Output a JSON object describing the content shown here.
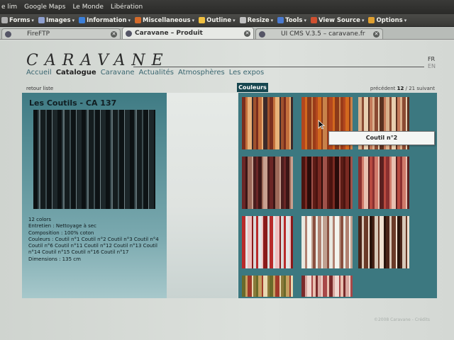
{
  "browser": {
    "menu_items": [
      "e lim",
      "Google Maps",
      "Le Monde",
      "Libération"
    ],
    "toolbar_items": [
      {
        "label": "Forms",
        "icon": "forms-icon"
      },
      {
        "label": "Images",
        "icon": "images-icon"
      },
      {
        "label": "Information",
        "icon": "info-icon"
      },
      {
        "label": "Miscellaneous",
        "icon": "misc-icon"
      },
      {
        "label": "Outline",
        "icon": "outline-icon"
      },
      {
        "label": "Resize",
        "icon": "resize-icon"
      },
      {
        "label": "Tools",
        "icon": "tools-icon"
      },
      {
        "label": "View Source",
        "icon": "view-source-icon"
      },
      {
        "label": "Options",
        "icon": "options-icon"
      }
    ],
    "tabs": [
      {
        "label": "FireFTP",
        "active": false
      },
      {
        "label": "Caravane – Produit",
        "active": true
      },
      {
        "label": "UI CMS V.3.5 – caravane.fr",
        "active": false
      }
    ]
  },
  "site": {
    "logo": "CARAVANE",
    "languages": [
      "FR",
      "EN"
    ],
    "nav": [
      {
        "label": "Accueil",
        "current": false
      },
      {
        "label": "Catalogue",
        "current": true
      },
      {
        "label": "Caravane",
        "current": false
      },
      {
        "label": "Actualités",
        "current": false
      },
      {
        "label": "Atmosphères",
        "current": false
      },
      {
        "label": "Les expos",
        "current": false
      }
    ],
    "back_link": "retour liste",
    "pager": {
      "prev": "précédent",
      "current": "12",
      "sep": " / ",
      "total": "21",
      "next": "suivant"
    }
  },
  "product": {
    "title": "Les Coutils - CA 137",
    "description_lines": [
      "12 colors",
      "Entretien : Nettoyage à sec",
      "Composition : 100% coton",
      "Couleurs : Coutil n°1 Coutil n°2 Coutil n°3 Coutil n°4",
      "Coutil n°6 Coutil n°11 Coutil n°12 Coutil n°13 Coutil",
      "n°14 Coutil n°15 Coutil n°16 Coutil n°17",
      "Dimensions : 135 cm"
    ]
  },
  "colors_panel": {
    "tab_label": "Couleurs",
    "tooltip": "Coutil n°2",
    "swatch_palettes": [
      [
        "#7a2e1e",
        "#c4703c",
        "#e8b27a",
        "#3c2a2a",
        "#a0522d"
      ],
      [
        "#b3471f",
        "#d2691e",
        "#8b3a1a",
        "#c8824a",
        "#9a3b18"
      ],
      [
        "#d9b08c",
        "#8a4a32",
        "#e8cfb0",
        "#5a3020",
        "#c47a5a"
      ],
      [
        "#6b2626",
        "#3b1616",
        "#9e6a5a",
        "#c8a090",
        "#4a1e1e"
      ],
      [
        "#4a1410",
        "#7a2a22",
        "#2a0c0a",
        "#a0524a",
        "#5c1c16"
      ],
      [
        "#8a3030",
        "#d07a6a",
        "#e8c0b0",
        "#5a2020",
        "#b84a40"
      ],
      [
        "#b82a2a",
        "#e4e4e4",
        "#f0c0c0",
        "#8a1a1a",
        "#dadada"
      ],
      [
        "#e8e8e0",
        "#b08070",
        "#f4f4ee",
        "#c0a090",
        "#8a5040"
      ],
      [
        "#4a2418",
        "#d8c8b8",
        "#6a3a28",
        "#f0e0d0",
        "#2a140c"
      ],
      [
        "#6a6a2a",
        "#c4a060",
        "#a03a2a",
        "#e8d8b0",
        "#8a7a3a"
      ],
      [
        "#7a2a2a",
        "#d8a8a0",
        "#f0d8d0",
        "#a84848",
        "#e8c0b0"
      ]
    ]
  },
  "footer": "©2008 Caravane - Crédits",
  "colors": {
    "accent": "#16464f",
    "panel": "#3c7880",
    "nav_link": "#3a6670"
  }
}
